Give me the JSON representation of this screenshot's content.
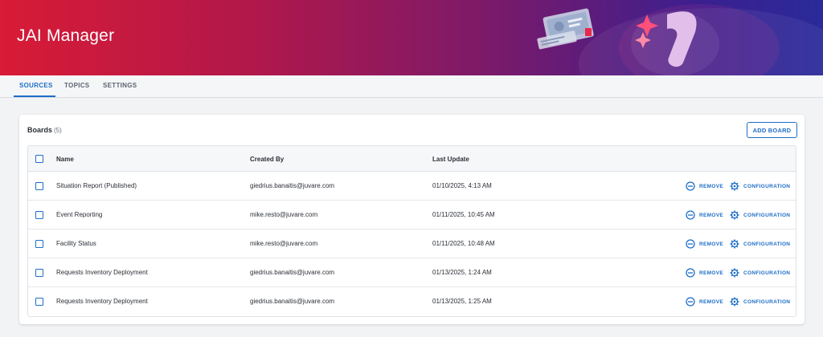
{
  "app": {
    "title": "JAI Manager"
  },
  "tabs": [
    {
      "label": "SOURCES",
      "active": true
    },
    {
      "label": "TOPICS",
      "active": false
    },
    {
      "label": "SETTINGS",
      "active": false
    }
  ],
  "boards": {
    "title": "Boards",
    "count": "(5)",
    "add_button": "ADD BOARD",
    "columns": {
      "name": "Name",
      "created_by": "Created By",
      "last_update": "Last Update"
    },
    "rows": [
      {
        "name": "Situation Report (Published)",
        "created_by": "giedrius.banaitis@juvare.com",
        "last_update": "01/10/2025, 4:13 AM"
      },
      {
        "name": "Event Reporting",
        "created_by": "mike.resto@juvare.com",
        "last_update": "01/11/2025, 10:45 AM"
      },
      {
        "name": "Facility Status",
        "created_by": "mike.resto@juvare.com",
        "last_update": "01/11/2025, 10:48 AM"
      },
      {
        "name": "Requests Inventory Deployment",
        "created_by": "giedrius.banaitis@juvare.com",
        "last_update": "01/13/2025, 1:24 AM"
      },
      {
        "name": "Requests Inventory Deployment",
        "created_by": "giedrius.banaitis@juvare.com",
        "last_update": "01/13/2025, 1:25 AM"
      }
    ],
    "actions": {
      "remove": "REMOVE",
      "configuration": "CONFIGURATION"
    }
  },
  "icons": {
    "remove": "minus-circle-icon",
    "configuration": "gear-icon"
  },
  "colors": {
    "accent": "#1e6ec8",
    "header_start": "#d81b36",
    "header_end": "#2a2a9a"
  }
}
